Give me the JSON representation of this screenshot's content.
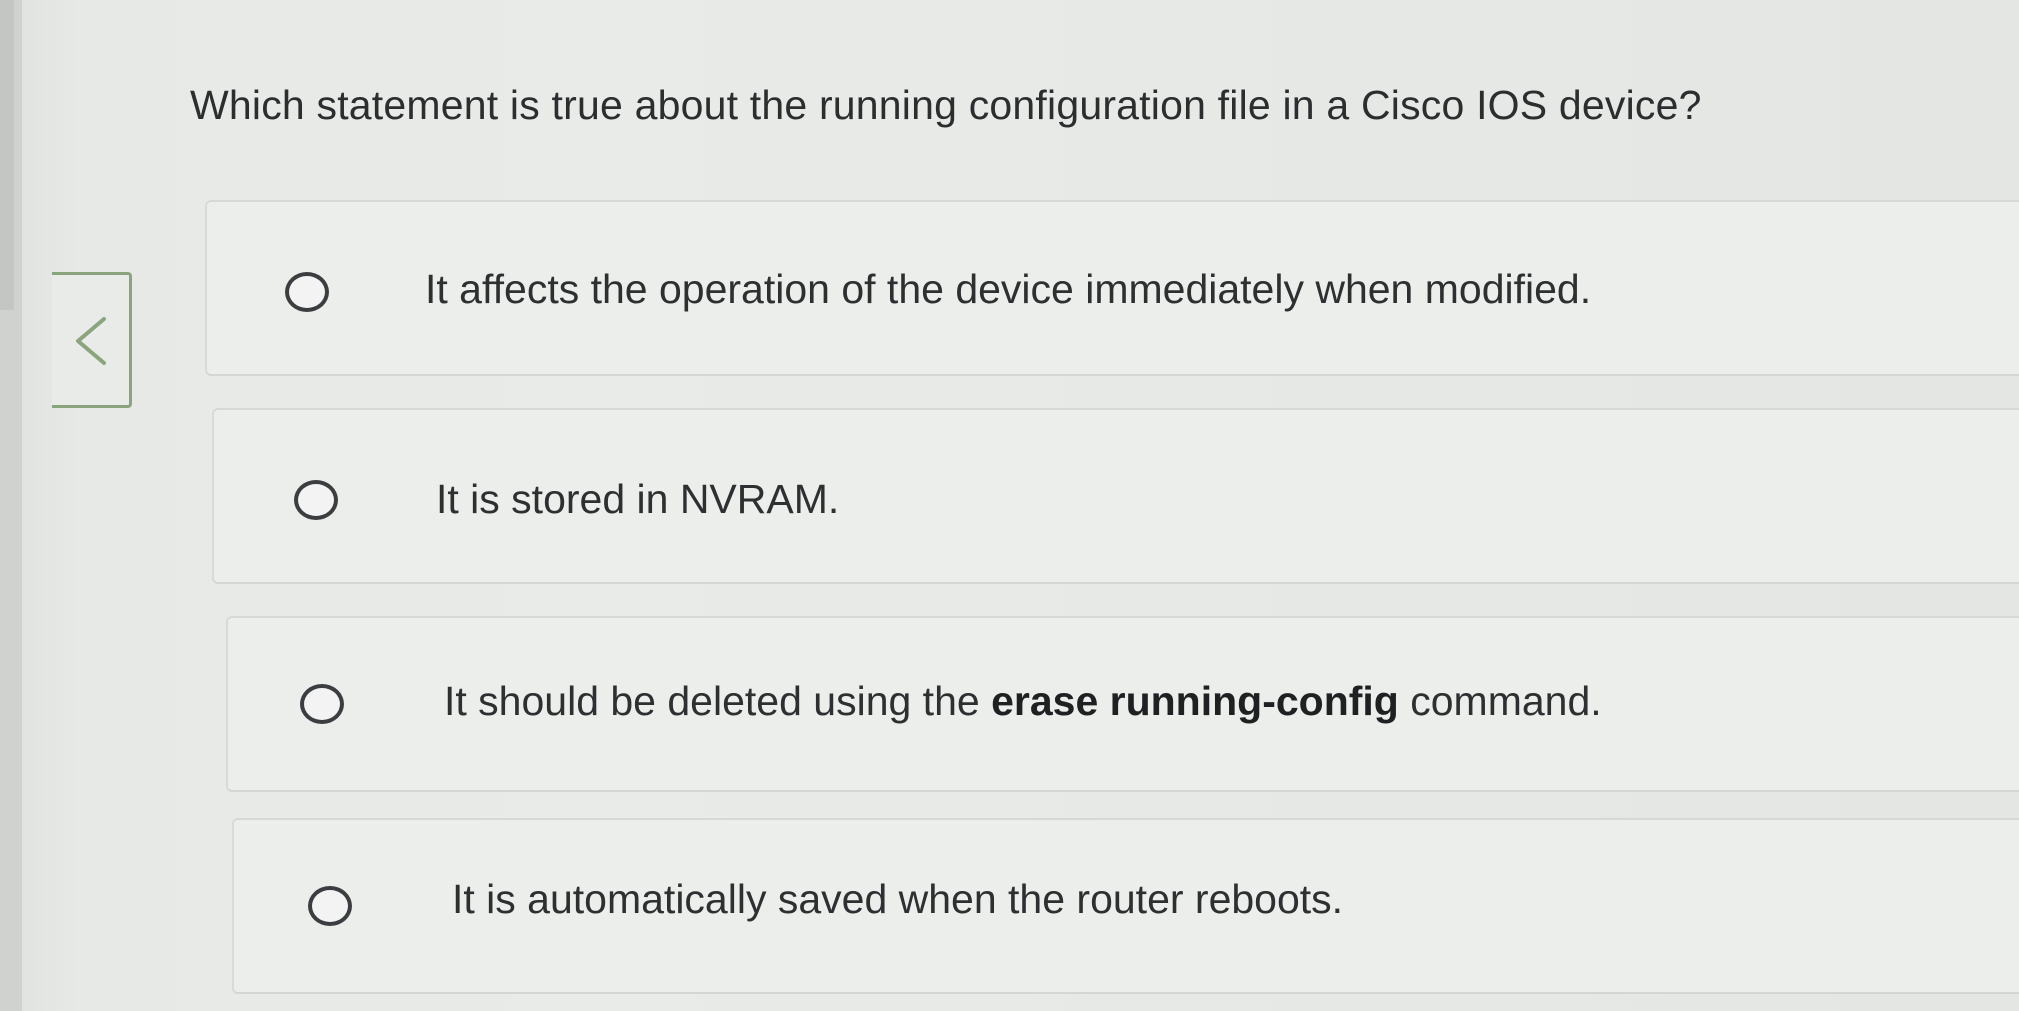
{
  "question": {
    "text": "Which statement is true about the running configuration file in a Cisco IOS device?"
  },
  "navigation": {
    "back_icon": "chevron-left-icon"
  },
  "options": [
    {
      "text": "It affects the operation of the device immediately when modified.",
      "selected": false
    },
    {
      "text": "It is stored in NVRAM.",
      "selected": false
    },
    {
      "text_before": "It should be deleted using the ",
      "text_bold": "erase running-config",
      "text_after": " command.",
      "selected": false
    },
    {
      "text": "It is automatically saved when the router reboots.",
      "selected": false
    }
  ],
  "colors": {
    "accent": "#8aa57d",
    "text": "#2d2f31",
    "background": "#e9ebe9"
  }
}
